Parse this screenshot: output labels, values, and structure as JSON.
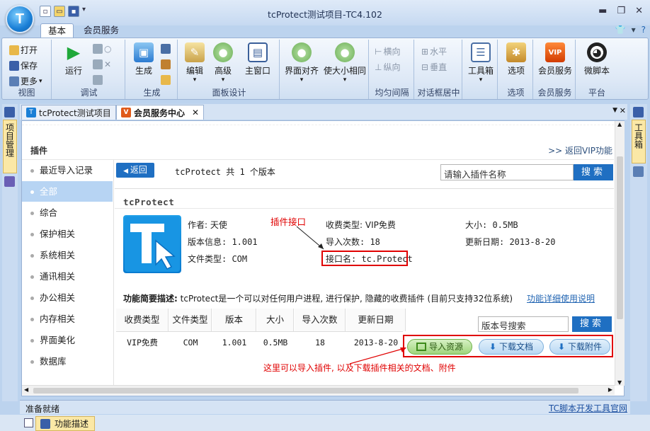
{
  "window": {
    "title": "tcProtect测试项目-TC4.102",
    "logo_text": "T"
  },
  "ribbon_tabs": {
    "basic": "基本",
    "member": "会员服务"
  },
  "ribbon": {
    "view": {
      "open": "打开",
      "save": "保存",
      "more": "更多",
      "label": "视图"
    },
    "debug": {
      "run": "运行",
      "label": "调试"
    },
    "generate": {
      "gen": "生成",
      "label": "生成"
    },
    "panel": {
      "edit": "编辑",
      "advanced": "高级",
      "main_window": "主窗口",
      "label": "面板设计"
    },
    "align": {
      "iface_align": "界面对齐",
      "make_same": "使大小相同",
      "horiz": "横向",
      "vert": "纵向",
      "label": "均匀间隔"
    },
    "center": {
      "horiz": "水平",
      "vert": "垂直",
      "label": "对话框居中"
    },
    "toolbox": {
      "toolbox": "工具箱"
    },
    "options": {
      "options": "选项",
      "label": "选项"
    },
    "member": {
      "vip": "会员服务",
      "label": "会员服务",
      "vip_icon_text": "VIP"
    },
    "platform": {
      "micro": "微脚本",
      "label": "平台"
    }
  },
  "doc_tabs": {
    "tab1": "tcProtect测试项目",
    "tab2": "会员服务中心"
  },
  "side": {
    "left_tab": "项目管理",
    "right_tab": "工具箱"
  },
  "plugin_page": {
    "header": "插件",
    "vip_link": ">> 返回VIP功能",
    "categories": [
      "最近导入记录",
      "全部",
      "综合",
      "保护相关",
      "系统相关",
      "通讯相关",
      "办公相关",
      "内存相关",
      "界面美化",
      "数据库"
    ],
    "back": "返回",
    "version_info": "tcProtect 共 1 个版本",
    "search_placeholder": "请输入插件名称",
    "search_btn": "搜索",
    "plugin_name": "tcProtect",
    "author": "作者: 天使",
    "version": "版本信息: 1.001",
    "file_type": "文件类型: COM",
    "charge": "收费类型: VIP免费",
    "imports": "导入次数: 18",
    "interface": "接口名: tc.Protect",
    "size": "大小: 0.5MB",
    "updated": "更新日期: 2013-8-20",
    "annotation1": "插件接口",
    "desc_label": "功能简要描述:",
    "desc_text": "tcProtect是一个可以对任何用户进程, 进行保护, 隐藏的收费插件 (目前只支持32位系统)",
    "doc_link": "功能详细使用说明",
    "table_headers": [
      "收费类型",
      "文件类型",
      "版本",
      "大小",
      "导入次数",
      "更新日期"
    ],
    "table_row": [
      "VIP免费",
      "COM",
      "1.001",
      "0.5MB",
      "18",
      "2013-8-20"
    ],
    "version_search_placeholder": "版本号搜索",
    "version_search_btn": "搜索",
    "import_btn": "导入资源",
    "download_doc_btn": "下载文档",
    "download_attach_btn": "下载附件",
    "annotation2": "这里可以导入插件, 以及下载插件相关的文档、附件"
  },
  "status": {
    "text": "准备就绪",
    "link": "TC脚本开发工具官网"
  },
  "bottom": {
    "func_tab": "功能描述"
  }
}
